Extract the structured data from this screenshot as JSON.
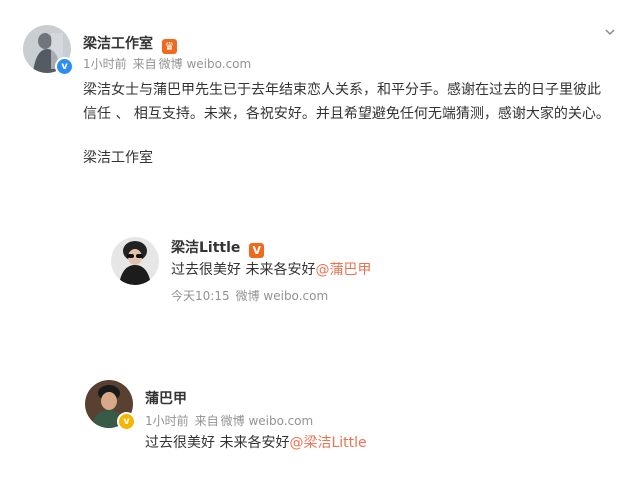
{
  "colors": {
    "mention": "#eb7350",
    "meta": "#939393",
    "verified_blue": "#2e8df2",
    "verified_gold": "#f7b500",
    "badge_orange": "#f06a1d"
  },
  "post1": {
    "author": "梁洁工作室",
    "time": "1小时前",
    "source_prefix": "来自",
    "source": "微博 weibo.com",
    "body": "梁洁女士与蒲巴甲先生已于去年结束恋人关系，和平分手。感谢在过去的日子里彼此信任 、 相互支持。未来，各祝安好。并且希望避免任何无端猜测，感谢大家的关心。",
    "signature": "梁洁工作室",
    "icons": [
      "crown-badge-icon",
      "verified-blue-icon",
      "chevron-down-icon"
    ]
  },
  "post2": {
    "author": "梁洁Little",
    "body_prefix": "过去很美好 未来各安好",
    "mention": "@蒲巴甲",
    "time": "今天10:15",
    "source": "微博 weibo.com",
    "icons": [
      "v-badge-icon"
    ]
  },
  "post3": {
    "author": "蒲巴甲",
    "time": "1小时前",
    "source_prefix": "来自",
    "source": "微博 weibo.com",
    "body_prefix": "过去很美好 未来各安好",
    "mention": "@梁洁Little",
    "icons": [
      "verified-gold-icon"
    ]
  }
}
